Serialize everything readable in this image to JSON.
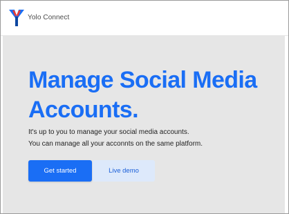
{
  "navbar": {
    "brand_name": "Yolo Connect",
    "logo_icon": "yolo-logo-icon",
    "colors": {
      "logo_blue": "#1a6ef5",
      "logo_red": "#e53935"
    }
  },
  "hero": {
    "title_line1": "Manage Social Media",
    "title_line2": "Accounts.",
    "description_line1": "It's up to you to manage your social media accounts.",
    "description_line2": "You can manage all your acconnts on the same platform.",
    "primary_button_label": "Get started",
    "secondary_button_label": "Live demo",
    "colors": {
      "accent": "#1a6ef5",
      "secondary_bg": "#dde9fb",
      "hero_bg": "#e6e6e6"
    }
  }
}
